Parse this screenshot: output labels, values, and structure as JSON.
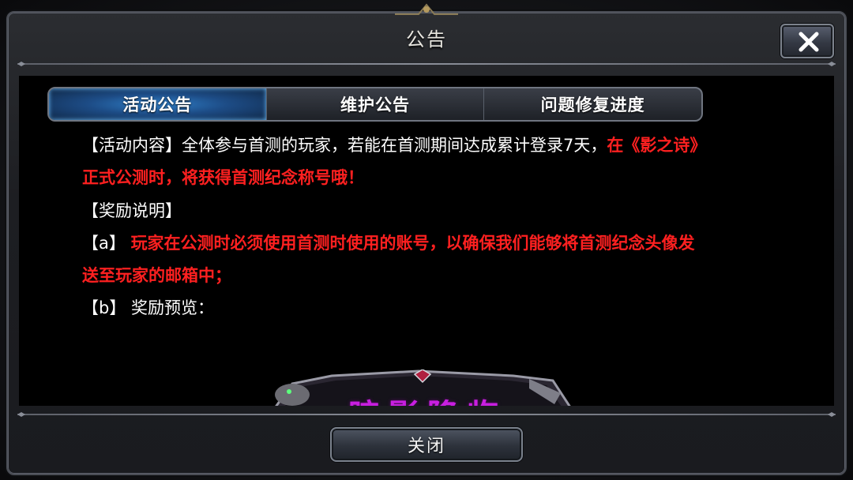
{
  "dialog": {
    "title": "公告",
    "close_icon": "close-x-icon",
    "footer_button": "关闭"
  },
  "tabs": [
    {
      "label": "活动公告",
      "active": true
    },
    {
      "label": "维护公告",
      "active": false
    },
    {
      "label": "问题修复进度",
      "active": false
    }
  ],
  "announcement": {
    "line1_white": "【活动内容】全体参与首测的玩家，若能在首测期间达成累计登录7天，",
    "line1_red": "在《影之诗》",
    "line2_red": "正式公测时，将获得首测纪念称号哦！",
    "reward_heading": "【奖励说明】",
    "item_a_prefix": "【a】",
    "item_a_red_1": "玩家在公测时必须使用首测时使用的账号，以确保我们能够将首测纪念头像发",
    "item_a_red_2": "送至玩家的邮箱中；",
    "item_b_prefix": "【b】",
    "item_b_text": "奖励预览："
  },
  "banner": {
    "partial_text": "暗影降临",
    "accent_color": "#c81fe0"
  },
  "colors": {
    "highlight_red": "#ff2020",
    "tab_active_blue": "#2f7fc8"
  }
}
